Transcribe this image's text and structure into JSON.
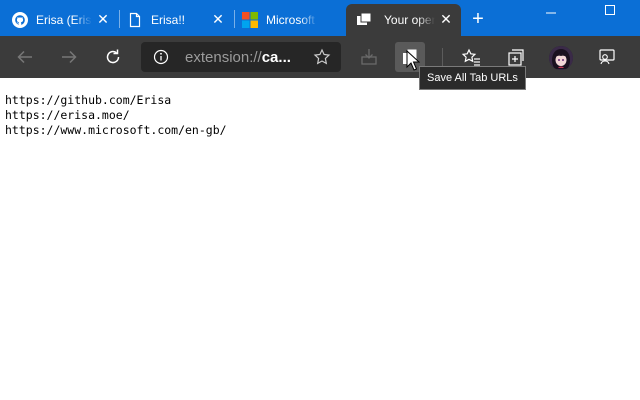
{
  "tabs": [
    {
      "title": "Erisa (Erisa",
      "favicon": "github-icon"
    },
    {
      "title": "Erisa!!",
      "favicon": "page-icon"
    },
    {
      "title": "Microsoft",
      "favicon": "microsoft-icon"
    },
    {
      "title": "Your open",
      "favicon": "extension-page-icon",
      "active": true
    }
  ],
  "new_tab_symbol": "+",
  "close_symbol": "✕",
  "address_bar": {
    "scheme_text": "extension://",
    "host_text": "ca...",
    "info_icon": "info-icon",
    "favorite_icon": "star-icon"
  },
  "toolbar_icons": [
    "back-icon",
    "forward-icon",
    "refresh-icon",
    "download-extension-icon",
    "save-all-tab-urls-icon",
    "favorites-icon",
    "collections-icon",
    "profile-avatar",
    "feedback-icon"
  ],
  "tooltip": {
    "text": "Save All Tab URLs"
  },
  "content": {
    "lines": [
      "https://github.com/Erisa",
      "https://erisa.moe/",
      "https://www.microsoft.com/en-gb/"
    ]
  },
  "colors": {
    "tabbar_bg": "#0b6fd6",
    "toolbar_bg": "#3b3b3b",
    "omnibox_bg": "#262626"
  }
}
